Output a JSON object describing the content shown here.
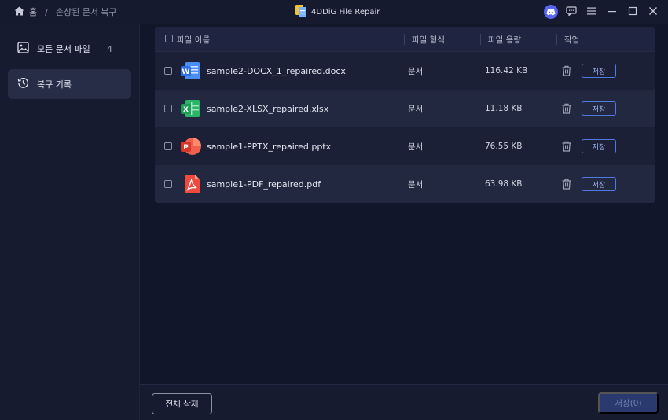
{
  "titlebar": {
    "home_label": "홈",
    "separator": "/",
    "current_page": "손상된 문서 복구",
    "app_title": "4DDiG File Repair"
  },
  "sidebar": {
    "items": [
      {
        "label": "모든 문서 파일",
        "count": "4",
        "icon": "image-icon",
        "active": false
      },
      {
        "label": "복구 기록",
        "icon": "history-icon",
        "active": true
      }
    ]
  },
  "table": {
    "headers": {
      "name": "파일 이름",
      "type": "파일 형식",
      "size": "파일 용량",
      "action": "작업"
    },
    "rows": [
      {
        "name": "sample2-DOCX_1_repaired.docx",
        "type": "문서",
        "size": "116.42 KB",
        "icon": "word-icon",
        "icon_color": "#2f6fe4",
        "letter": "W",
        "save": "저장"
      },
      {
        "name": "sample2-XLSX_repaired.xlsx",
        "type": "문서",
        "size": "11.18 KB",
        "icon": "excel-icon",
        "icon_color": "#1f9d55",
        "letter": "X",
        "save": "저장"
      },
      {
        "name": "sample1-PPTX_repaired.pptx",
        "type": "문서",
        "size": "76.55 KB",
        "icon": "powerpoint-icon",
        "icon_color": "#e4483c",
        "letter": "P",
        "save": "저장"
      },
      {
        "name": "sample1-PDF_repaired.pdf",
        "type": "문서",
        "size": "63.98 KB",
        "icon": "pdf-icon",
        "icon_color": "#e4483c",
        "letter": "",
        "save": "저장"
      }
    ]
  },
  "footer": {
    "delete_all": "전체 삭제",
    "save_all": "저장(0)"
  },
  "colors": {
    "accent": "#4f7be0",
    "background": "#12162a",
    "sidebar_active": "#272d47"
  }
}
